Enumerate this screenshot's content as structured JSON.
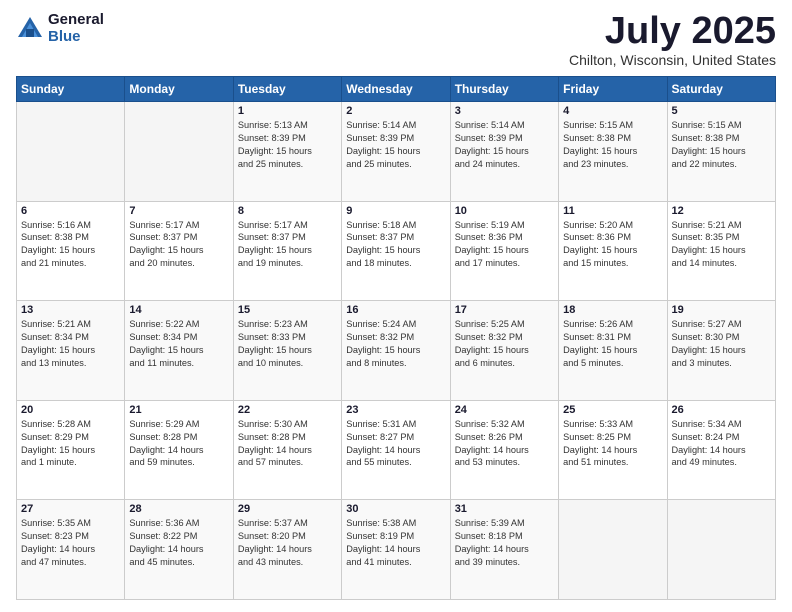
{
  "logo": {
    "general": "General",
    "blue": "Blue"
  },
  "header": {
    "month_year": "July 2025",
    "location": "Chilton, Wisconsin, United States"
  },
  "weekdays": [
    "Sunday",
    "Monday",
    "Tuesday",
    "Wednesday",
    "Thursday",
    "Friday",
    "Saturday"
  ],
  "weeks": [
    [
      {
        "day": "",
        "info": ""
      },
      {
        "day": "",
        "info": ""
      },
      {
        "day": "1",
        "info": "Sunrise: 5:13 AM\nSunset: 8:39 PM\nDaylight: 15 hours\nand 25 minutes."
      },
      {
        "day": "2",
        "info": "Sunrise: 5:14 AM\nSunset: 8:39 PM\nDaylight: 15 hours\nand 25 minutes."
      },
      {
        "day": "3",
        "info": "Sunrise: 5:14 AM\nSunset: 8:39 PM\nDaylight: 15 hours\nand 24 minutes."
      },
      {
        "day": "4",
        "info": "Sunrise: 5:15 AM\nSunset: 8:38 PM\nDaylight: 15 hours\nand 23 minutes."
      },
      {
        "day": "5",
        "info": "Sunrise: 5:15 AM\nSunset: 8:38 PM\nDaylight: 15 hours\nand 22 minutes."
      }
    ],
    [
      {
        "day": "6",
        "info": "Sunrise: 5:16 AM\nSunset: 8:38 PM\nDaylight: 15 hours\nand 21 minutes."
      },
      {
        "day": "7",
        "info": "Sunrise: 5:17 AM\nSunset: 8:37 PM\nDaylight: 15 hours\nand 20 minutes."
      },
      {
        "day": "8",
        "info": "Sunrise: 5:17 AM\nSunset: 8:37 PM\nDaylight: 15 hours\nand 19 minutes."
      },
      {
        "day": "9",
        "info": "Sunrise: 5:18 AM\nSunset: 8:37 PM\nDaylight: 15 hours\nand 18 minutes."
      },
      {
        "day": "10",
        "info": "Sunrise: 5:19 AM\nSunset: 8:36 PM\nDaylight: 15 hours\nand 17 minutes."
      },
      {
        "day": "11",
        "info": "Sunrise: 5:20 AM\nSunset: 8:36 PM\nDaylight: 15 hours\nand 15 minutes."
      },
      {
        "day": "12",
        "info": "Sunrise: 5:21 AM\nSunset: 8:35 PM\nDaylight: 15 hours\nand 14 minutes."
      }
    ],
    [
      {
        "day": "13",
        "info": "Sunrise: 5:21 AM\nSunset: 8:34 PM\nDaylight: 15 hours\nand 13 minutes."
      },
      {
        "day": "14",
        "info": "Sunrise: 5:22 AM\nSunset: 8:34 PM\nDaylight: 15 hours\nand 11 minutes."
      },
      {
        "day": "15",
        "info": "Sunrise: 5:23 AM\nSunset: 8:33 PM\nDaylight: 15 hours\nand 10 minutes."
      },
      {
        "day": "16",
        "info": "Sunrise: 5:24 AM\nSunset: 8:32 PM\nDaylight: 15 hours\nand 8 minutes."
      },
      {
        "day": "17",
        "info": "Sunrise: 5:25 AM\nSunset: 8:32 PM\nDaylight: 15 hours\nand 6 minutes."
      },
      {
        "day": "18",
        "info": "Sunrise: 5:26 AM\nSunset: 8:31 PM\nDaylight: 15 hours\nand 5 minutes."
      },
      {
        "day": "19",
        "info": "Sunrise: 5:27 AM\nSunset: 8:30 PM\nDaylight: 15 hours\nand 3 minutes."
      }
    ],
    [
      {
        "day": "20",
        "info": "Sunrise: 5:28 AM\nSunset: 8:29 PM\nDaylight: 15 hours\nand 1 minute."
      },
      {
        "day": "21",
        "info": "Sunrise: 5:29 AM\nSunset: 8:28 PM\nDaylight: 14 hours\nand 59 minutes."
      },
      {
        "day": "22",
        "info": "Sunrise: 5:30 AM\nSunset: 8:28 PM\nDaylight: 14 hours\nand 57 minutes."
      },
      {
        "day": "23",
        "info": "Sunrise: 5:31 AM\nSunset: 8:27 PM\nDaylight: 14 hours\nand 55 minutes."
      },
      {
        "day": "24",
        "info": "Sunrise: 5:32 AM\nSunset: 8:26 PM\nDaylight: 14 hours\nand 53 minutes."
      },
      {
        "day": "25",
        "info": "Sunrise: 5:33 AM\nSunset: 8:25 PM\nDaylight: 14 hours\nand 51 minutes."
      },
      {
        "day": "26",
        "info": "Sunrise: 5:34 AM\nSunset: 8:24 PM\nDaylight: 14 hours\nand 49 minutes."
      }
    ],
    [
      {
        "day": "27",
        "info": "Sunrise: 5:35 AM\nSunset: 8:23 PM\nDaylight: 14 hours\nand 47 minutes."
      },
      {
        "day": "28",
        "info": "Sunrise: 5:36 AM\nSunset: 8:22 PM\nDaylight: 14 hours\nand 45 minutes."
      },
      {
        "day": "29",
        "info": "Sunrise: 5:37 AM\nSunset: 8:20 PM\nDaylight: 14 hours\nand 43 minutes."
      },
      {
        "day": "30",
        "info": "Sunrise: 5:38 AM\nSunset: 8:19 PM\nDaylight: 14 hours\nand 41 minutes."
      },
      {
        "day": "31",
        "info": "Sunrise: 5:39 AM\nSunset: 8:18 PM\nDaylight: 14 hours\nand 39 minutes."
      },
      {
        "day": "",
        "info": ""
      },
      {
        "day": "",
        "info": ""
      }
    ]
  ]
}
